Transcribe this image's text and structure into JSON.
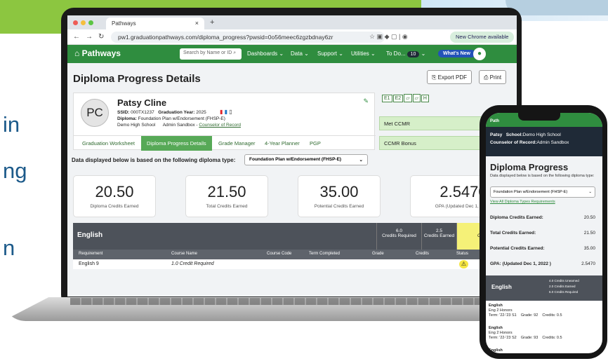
{
  "side_text": [
    "in",
    "ng",
    "n"
  ],
  "browser": {
    "tab_title": "Pathways",
    "url": "pw1.graduationpathways.com/diploma_progress?pwsid=0o56meec6zgzbdnay6zr",
    "chrome_available": "New Chrome available"
  },
  "app": {
    "logo": "Pathways",
    "search_placeholder": "Search by Name or ID",
    "menu": [
      "Dashboards",
      "Data",
      "Support",
      "Utilities",
      "To Do..."
    ],
    "todo_count": "10",
    "whats_new": "What's New"
  },
  "page": {
    "title": "Diploma Progress Details",
    "export_pdf": "Export PDF",
    "print": "Print",
    "student": {
      "initials": "PC",
      "name": "Patsy Cline",
      "ssid_label": "SSID:",
      "ssid": "000TX1237",
      "grad_label": "Graduation Year:",
      "grad_year": "2025",
      "diploma_label": "Diploma:",
      "diploma": "Foundation Plan w/Endorsement (FHSP-E)",
      "school": "Demo High School",
      "counselor_prefix": "Admin Sandbox -",
      "counselor_link": "Counselor of Record"
    },
    "subtabs": [
      "Graduation Worksheet",
      "Diploma Progress Details",
      "Grade Manager",
      "4-Year Planner",
      "PGP"
    ],
    "badges": [
      "E1",
      "E2"
    ],
    "ccmr": [
      "Met CCMR",
      "CCMR Bonus"
    ],
    "diploma_type_text": "Data displayed below is based on the following diploma type:",
    "diploma_type_value": "Foundation Plan w/Endorsement (FHSP-E)",
    "stats": [
      {
        "value": "20.50",
        "label": "Diploma Credits Earned"
      },
      {
        "value": "21.50",
        "label": "Total Credits Earned"
      },
      {
        "value": "35.00",
        "label": "Potential Credits Earned"
      },
      {
        "value": "2.5470",
        "label": "GPA (Updated Dec 1, 2022)"
      }
    ],
    "english": {
      "title": "English",
      "credits_required": "6.0",
      "credits_required_label": "Credits Required",
      "credits_earned": "2.5",
      "credits_earned_label": "Credits Earned",
      "credits_unearned": "3.5",
      "credits_unearned_label": "Credits U"
    },
    "columns": [
      "Requirement",
      "Course Name",
      "Course Code",
      "Term Completed",
      "Grade",
      "Credits",
      "Status"
    ],
    "row": {
      "requirement": "English 9",
      "course": "1.0 Credit Required"
    }
  },
  "phone": {
    "logo": "Path",
    "student_name": "Patsy",
    "school_label": "School:",
    "school": "Demo High School",
    "counselor_label": "Counselor of Record:",
    "counselor": "Admin Sandbox",
    "title": "Diploma Progress",
    "desc": "Data displayed below is based on the following diploma type:",
    "select": "Foundation Plan w/Endorsement (FHSP-E)",
    "link": "View All Diploma Types Requirements",
    "stats": [
      {
        "label": "Diploma Credits Earned:",
        "value": "20.50"
      },
      {
        "label": "Total Credits Earned:",
        "value": "21.50"
      },
      {
        "label": "Potential Credits Earned:",
        "value": "35.00"
      },
      {
        "label": "GPA: (Updated Dec 1, 2022 )",
        "value": "2.5470"
      }
    ],
    "english_title": "English",
    "english_credits": [
      "4.0 Credits Unearned",
      "2.0 Credits Earned",
      "6.0 Credits Required"
    ],
    "courses": [
      {
        "title": "English",
        "name": "Eng 2 Honors",
        "term": "Term: '22-'23 S1",
        "grade": "Grade: 92",
        "credits": "Credits: 0.5"
      },
      {
        "title": "English",
        "name": "Eng 2 Honors",
        "term": "Term: '22-'23 S2",
        "grade": "Grade: 93",
        "credits": "Credits: 0.5"
      },
      {
        "title": "English",
        "name": "",
        "term": "",
        "grade": "",
        "credits": ""
      }
    ]
  }
}
